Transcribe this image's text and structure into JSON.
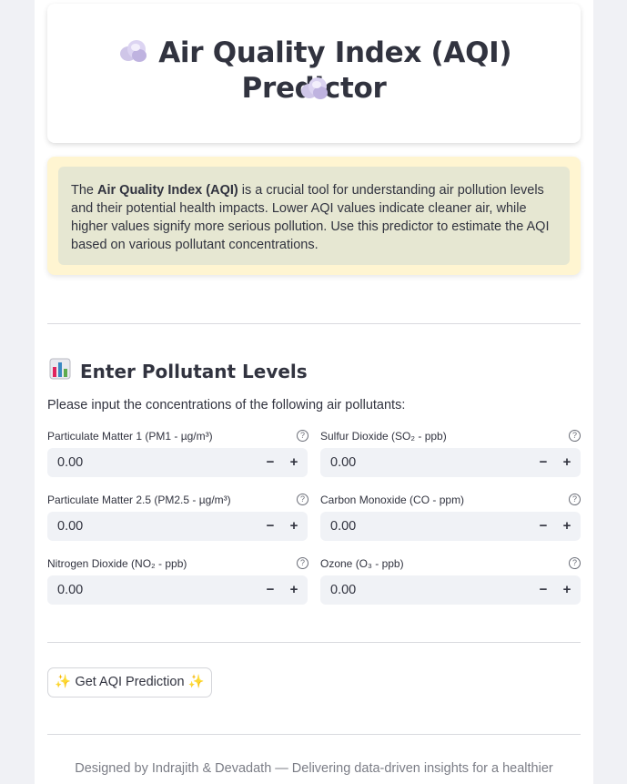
{
  "header": {
    "title": "Air Quality Index (AQI) Predictor",
    "icon": "cloud-icon"
  },
  "info": {
    "bold": "Air Quality Index (AQI)",
    "prefix": "The ",
    "body": " is a crucial tool for understanding air pollution levels and their potential health impacts. Lower AQI values indicate cleaner air, while higher values signify more serious pollution. Use this predictor to estimate the AQI based on various pollutant concentrations."
  },
  "section": {
    "title": "Enter Pollutant Levels",
    "icon": "bar-chart-icon",
    "subtitle": "Please input the concentrations of the following air pollutants:"
  },
  "fields": [
    {
      "label": "Particulate Matter 1 (PM1 - µg/m³)",
      "value": "0.00"
    },
    {
      "label": "Sulfur Dioxide (SO₂ - ppb)",
      "value": "0.00"
    },
    {
      "label": "Particulate Matter 2.5 (PM2.5 - µg/m³)",
      "value": "0.00"
    },
    {
      "label": "Carbon Monoxide (CO - ppm)",
      "value": "0.00"
    },
    {
      "label": "Nitrogen Dioxide (NO₂ - ppb)",
      "value": "0.00"
    },
    {
      "label": "Ozone (O₃ - ppb)",
      "value": "0.00"
    }
  ],
  "stepper": {
    "minus": "−",
    "plus": "+",
    "help": "?"
  },
  "predict_button": {
    "label": "✨ Get AQI Prediction ✨"
  },
  "footer": {
    "text": "Designed by Indrajith & Devadath — Delivering data-driven insights for a healthier"
  }
}
